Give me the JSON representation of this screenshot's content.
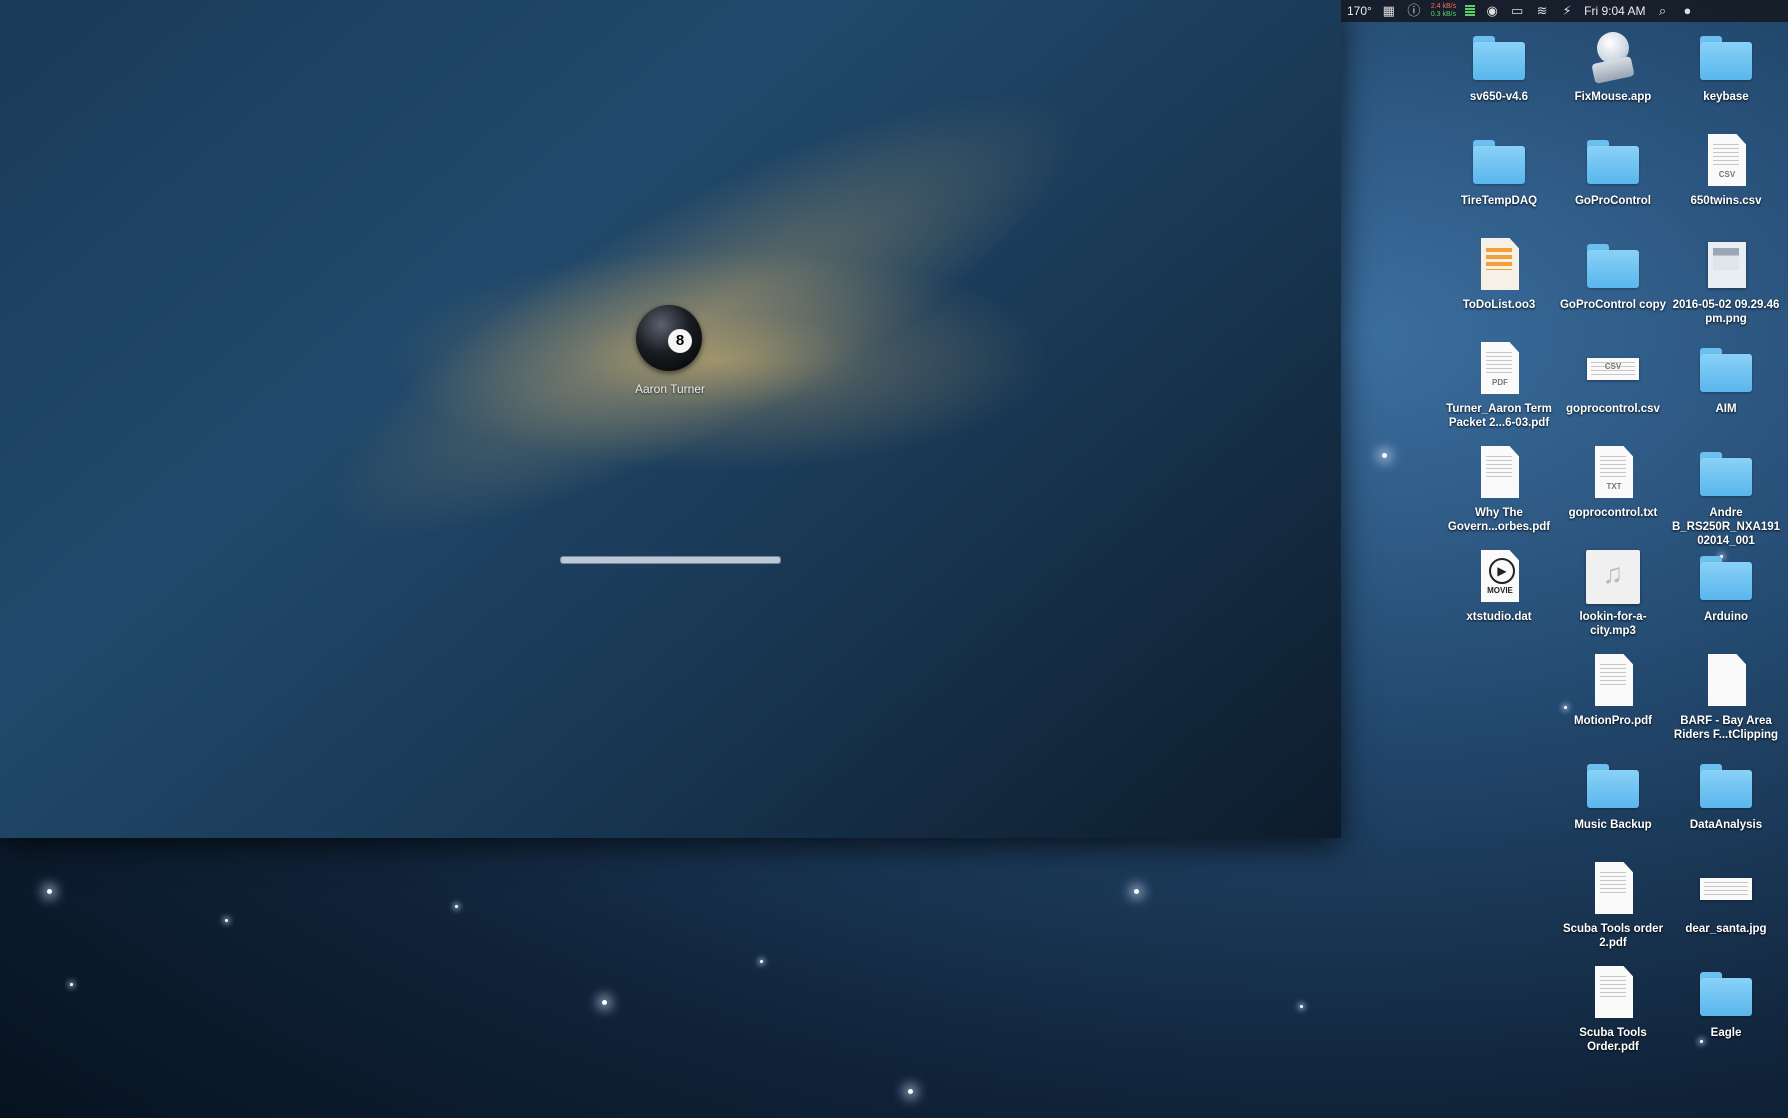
{
  "login": {
    "username": "Aaron Turner",
    "avatar_icon": "eight-ball-icon",
    "avatar_number": "8",
    "progress_fraction": 1.0
  },
  "menubar": {
    "temperature": "170°",
    "net_up": "2.4 kB/s",
    "net_down": "0.3 kB/s",
    "clock": "Fri 9:04 AM",
    "icons": [
      "photo-icon",
      "info-icon",
      "memory-icon",
      "record-icon",
      "drive-icon",
      "wifi-icon",
      "battery-charging-icon",
      "search-icon",
      "user-icon"
    ]
  },
  "desktop": {
    "icons": [
      {
        "label": "sv650-v4.6",
        "kind": "folder"
      },
      {
        "label": "FixMouse.app",
        "kind": "app"
      },
      {
        "label": "keybase",
        "kind": "folder"
      },
      {
        "label": "TireTempDAQ",
        "kind": "folder"
      },
      {
        "label": "GoProControl",
        "kind": "folder"
      },
      {
        "label": "650twins.csv",
        "kind": "csv",
        "type": "CSV"
      },
      {
        "label": "ToDoList.oo3",
        "kind": "outline"
      },
      {
        "label": "GoProControl copy",
        "kind": "folder"
      },
      {
        "label": "2016-05-02 09.29.46 pm.png",
        "kind": "image"
      },
      {
        "label": "Turner_Aaron Term Packet 2...6-03.pdf",
        "kind": "pdf",
        "type": "PDF"
      },
      {
        "label": "goprocontrol.csv",
        "kind": "csv",
        "type": "CSV"
      },
      {
        "label": "AIM",
        "kind": "folder"
      },
      {
        "label": "Why The Govern...orbes.pdf",
        "kind": "pdf"
      },
      {
        "label": "goprocontrol.txt",
        "kind": "txt",
        "type": "TXT"
      },
      {
        "label": "Andre B_RS250R_NXA19102014_001",
        "kind": "folder"
      },
      {
        "label": "xtstudio.dat",
        "kind": "movie",
        "type": "MOVIE"
      },
      {
        "label": "lookin-for-a-city.mp3",
        "kind": "music"
      },
      {
        "label": "Arduino",
        "kind": "folder"
      },
      {
        "label": "MotionPro.pdf",
        "kind": "pdf"
      },
      {
        "label": "BARF - Bay Area Riders F...tClipping",
        "kind": "clipping"
      },
      {
        "label": "Music Backup",
        "kind": "folder"
      },
      {
        "label": "DataAnalysis",
        "kind": "folder"
      },
      {
        "label": "Scuba Tools order 2.pdf",
        "kind": "pdf"
      },
      {
        "label": "dear_santa.jpg",
        "kind": "wide-image"
      },
      {
        "label": "Scuba Tools Order.pdf",
        "kind": "pdf"
      },
      {
        "label": "Eagle",
        "kind": "folder"
      }
    ]
  }
}
